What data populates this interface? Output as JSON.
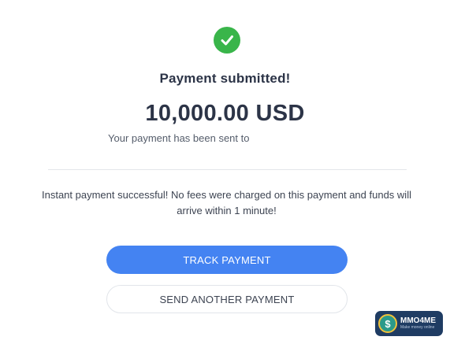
{
  "status": {
    "icon": "check-circle-icon",
    "title": "Payment submitted!",
    "amount": "10,000.00 USD",
    "sent_to_text": "Your payment has been sent to"
  },
  "message": "Instant payment successful! No fees were charged on this payment and funds will arrive within 1 minute!",
  "actions": {
    "track_label": "TRACK PAYMENT",
    "send_another_label": "SEND ANOTHER PAYMENT"
  },
  "watermark": {
    "name": "MMO4ME",
    "tagline": "Make money online",
    "logo_symbol": "$"
  },
  "colors": {
    "success": "#39b54a",
    "primary": "#4483f2",
    "text_dark": "#2c3447",
    "watermark_bg": "#1f3c63"
  }
}
